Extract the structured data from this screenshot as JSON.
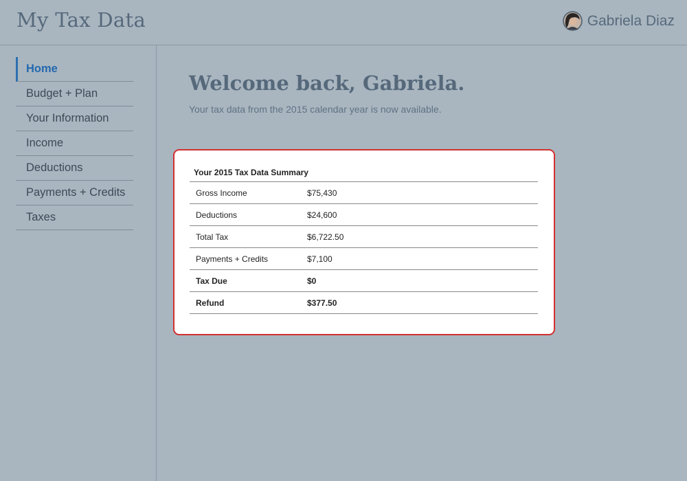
{
  "header": {
    "app_title": "My Tax Data",
    "user_name": "Gabriela Diaz"
  },
  "sidebar": {
    "items": [
      {
        "label": "Home",
        "active": true
      },
      {
        "label": "Budget + Plan"
      },
      {
        "label": "Your Information"
      },
      {
        "label": "Income"
      },
      {
        "label": "Deductions"
      },
      {
        "label": "Payments + Credits"
      },
      {
        "label": "Taxes"
      }
    ]
  },
  "main": {
    "welcome": "Welcome back, Gabriela.",
    "subtitle": "Your tax data from the 2015 calendar year is now available."
  },
  "summary": {
    "title": "Your 2015 Tax Data Summary",
    "rows": [
      {
        "label": "Gross Income",
        "value": "$75,430"
      },
      {
        "label": "Deductions",
        "value": "$24,600"
      },
      {
        "label": "Total Tax",
        "value": "$6,722.50"
      },
      {
        "label": "Payments + Credits",
        "value": "$7,100"
      },
      {
        "label": "Tax Due",
        "value": "$0"
      },
      {
        "label": "Refund",
        "value": "$377.50"
      }
    ]
  },
  "colors": {
    "background": "#a9b6c0",
    "accent": "#2468ad",
    "highlight_border": "#d32f2f"
  }
}
